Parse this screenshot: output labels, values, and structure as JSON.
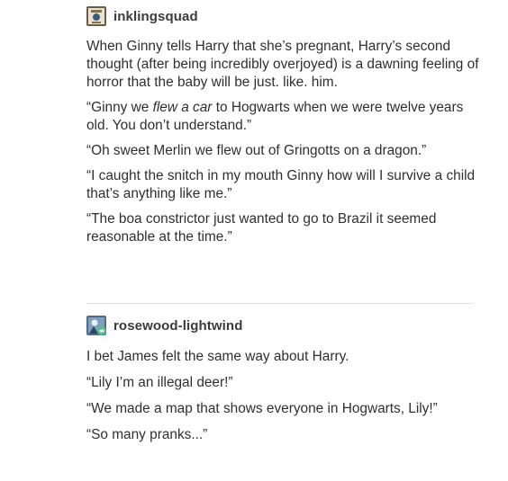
{
  "posts": [
    {
      "username": "inklingsquad",
      "avatar_icon": "book-cover-avatar",
      "paragraphs": [
        "When Ginny tells Harry that she’s pregnant, Harry’s second thought (after being incredibly overjoyed) is a dawning feeling of horror that the baby will be just. like. him.",
        {
          "before": "“Ginny we ",
          "emphasis": "flew a car",
          "after": " to Hogwarts when we were twelve years old. You don’t understand.”"
        },
        "“Oh sweet Merlin we flew out of Gringotts on a dragon.”",
        "“I caught the snitch in my mouth Ginny how will I survive a child that’s anything like me.”",
        "“The boa constrictor just wanted to go to Brazil it seemed reasonable at the time.”"
      ]
    },
    {
      "username": "rosewood-lightwind",
      "avatar_icon": "reblog-avatar",
      "paragraphs": [
        "I bet James felt the same way about Harry.",
        "“Lily I’m an illegal deer!”",
        "“We made a map that shows everyone in Hogwarts, Lily!”",
        "“So many pranks...”"
      ]
    }
  ],
  "colors": {
    "text": "#2f2f2f",
    "username": "#3b3b3b",
    "divider": "#e3e3e3",
    "reblog_badge": "#56bc8a"
  }
}
